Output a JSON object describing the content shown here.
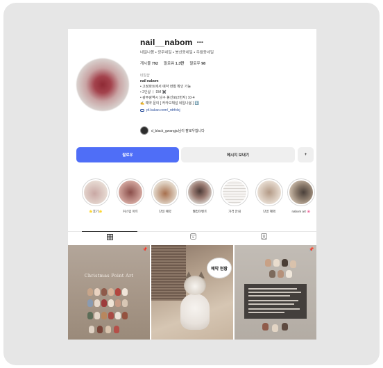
{
  "profile": {
    "username": "nail__nabom",
    "categories": "네일나봄 • 광주네일 • 봉선동네일 • 주월동네일",
    "stats": [
      {
        "label": "게시물",
        "value": "792"
      },
      {
        "label": "팔로워",
        "value": "1.3만"
      },
      {
        "label": "팔로우",
        "value": "98"
      }
    ],
    "bio": {
      "category": "네일샵",
      "name": "nail nabom",
      "lines": [
        "• 고정파트에서 예약 현황 확인 가능",
        "• 2인샵 ㅣ DM ✖️",
        "• 광주광역시 남구 봉선로(2번지) 10-4",
        "✍️ 예약 문의 [ 카카오채널 네일나봄 ] ⬇️"
      ],
      "link": "pf.kakao.com/_rdrfxlxj"
    },
    "followed_by": "d_black_gwangju님이 팔로우합니다"
  },
  "actions": {
    "follow": "팔로우",
    "message": "메시지 보내기",
    "add_icon": "+"
  },
  "highlights": [
    {
      "label": "⭐️후기⭐️",
      "colors": [
        "#e8dcd4",
        "#c9a8a4"
      ]
    },
    {
      "label": "커스텀 아트",
      "colors": [
        "#d4a8a0",
        "#8a4e4a"
      ]
    },
    {
      "label": "단일 예약",
      "colors": [
        "#e2d6c8",
        "#a7704e"
      ]
    },
    {
      "label": "웰컴이벤트",
      "colors": [
        "#d8d2cc",
        "#4b3a36"
      ]
    },
    {
      "label": "가격 안내",
      "colors": [
        "#f6f4f2",
        "#d8d4d0"
      ]
    },
    {
      "label": "단골 혜택",
      "colors": [
        "#e8ddd2",
        "#b39a86"
      ]
    },
    {
      "label": "nabom art 🌸",
      "colors": [
        "#4a403a",
        "#c9b9a8"
      ]
    }
  ],
  "tabs": [
    {
      "name": "grid-icon",
      "active": true
    },
    {
      "name": "reels-icon",
      "active": false
    },
    {
      "name": "tagged-icon",
      "active": false
    }
  ],
  "posts": [
    {
      "title": "Christmas Point Art"
    },
    {
      "bubble": "예약 현황"
    },
    {}
  ]
}
